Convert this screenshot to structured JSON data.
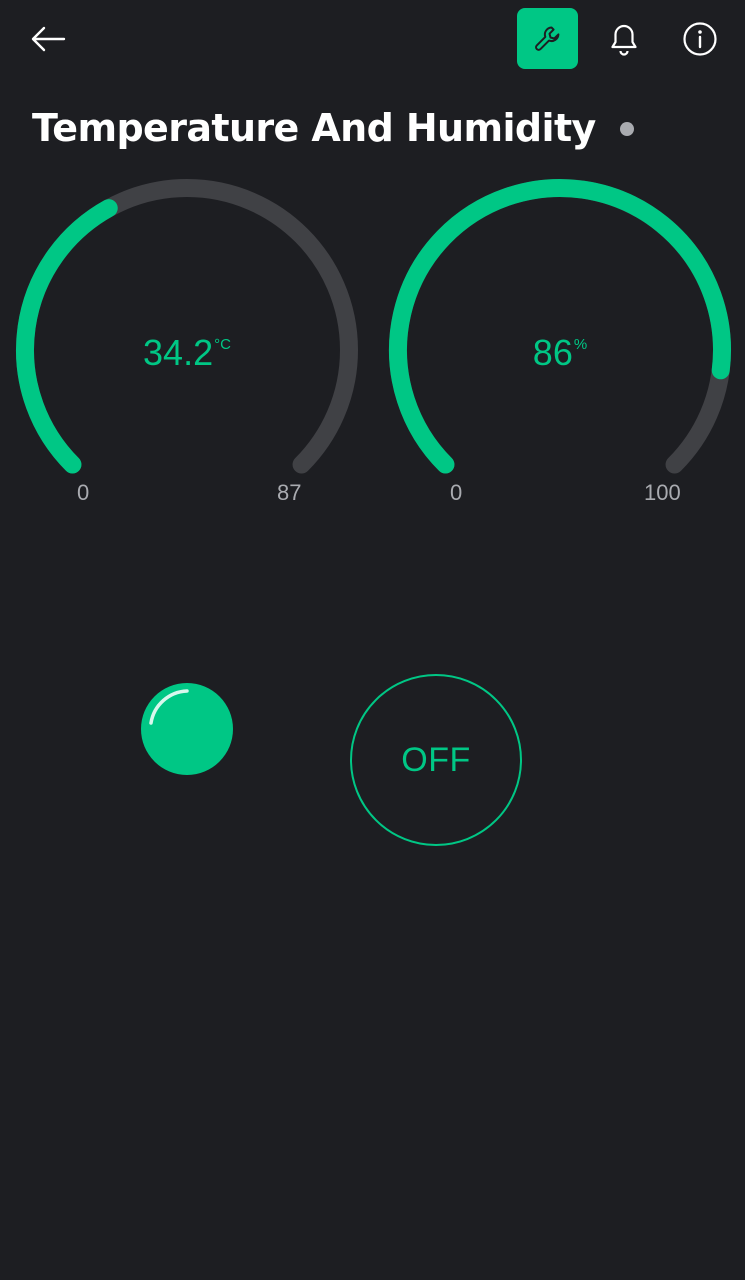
{
  "colors": {
    "accent": "#00c785",
    "track": "#404145",
    "background": "#1d1e22",
    "muted": "#a9abb0"
  },
  "header": {
    "icons": [
      "back-arrow-icon",
      "wrench-icon",
      "bell-icon",
      "info-icon"
    ]
  },
  "page": {
    "title": "Temperature And Humidity",
    "status": "offline"
  },
  "gauges": [
    {
      "value": "34.2",
      "unit": "°C",
      "min": "0",
      "max": "87",
      "fraction": 0.393
    },
    {
      "value": "86",
      "unit": "%",
      "min": "0",
      "max": "100",
      "fraction": 0.86
    }
  ],
  "led": {
    "state": "on"
  },
  "switch": {
    "label": "OFF"
  }
}
